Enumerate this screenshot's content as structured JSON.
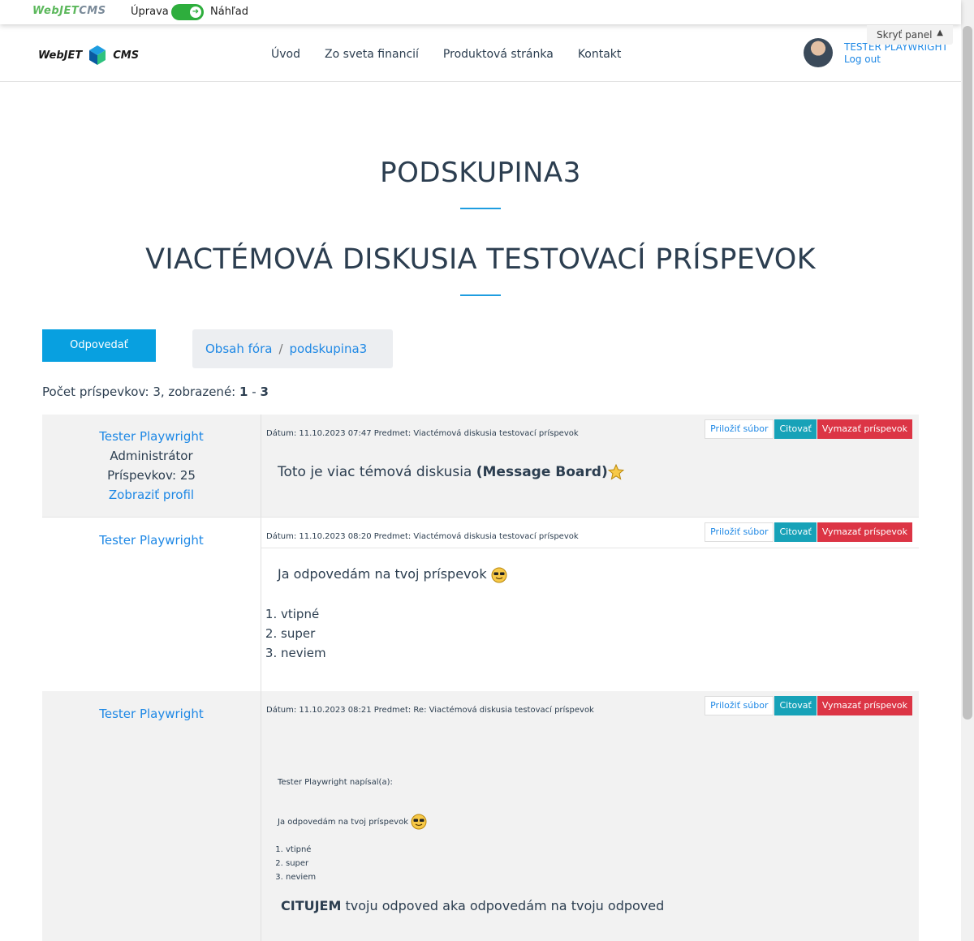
{
  "editbar": {
    "logo_a": "WebJET",
    "logo_b": "CMS",
    "mode_edit": "Úprava",
    "mode_preview": "Náhľad",
    "toggle_icon": "arrow-right-icon",
    "toggle_color": "#2eae3d"
  },
  "header": {
    "logo_a": "WebJET",
    "logo_b": "CMS",
    "nav": [
      "Úvod",
      "Zo sveta financií",
      "Produktová stránka",
      "Kontakt"
    ],
    "user_name": "TESTER PLAYWRIGHT",
    "logout": "Log out",
    "hide_panel": "Skryť panel"
  },
  "page": {
    "title1": "PODSKUPINA3",
    "title2": "VIACTÉMOVÁ DISKUSIA TESTOVACÍ PRÍSPEVOK",
    "accent_color": "#1e9de0",
    "reply_label": "Odpovedať",
    "breadcrumb": [
      "Obsah fóra",
      "podskupina3"
    ],
    "breadcrumb_sep": "/",
    "count_label": "Počet príspevkov: 3, zobrazené:",
    "count_from": "1",
    "count_dash": "-",
    "count_to": "3"
  },
  "actions": {
    "attach": "Priložiť súbor",
    "quote": "Citovať",
    "delete": "Vymazať príspevok"
  },
  "posts": [
    {
      "author": "Tester Playwright",
      "role": "Administrátor",
      "posts_count": "Príspevkov: 25",
      "profile_link": "Zobraziť profil",
      "meta": "Dátum: 11.10.2023 07:47 Predmet: Viactémová diskusia testovací príspevok",
      "text": "Toto je viac témová diskusia",
      "bold": "(Message Board)",
      "emoji": "star-emoji-icon"
    },
    {
      "author": "Tester Playwright",
      "meta": "Dátum: 11.10.2023 08:20 Predmet: Viactémová diskusia testovací príspevok",
      "text": "Ja odpovedám na tvoj príspevok",
      "emoji": "cool-sunglasses-emoji-icon",
      "list": [
        "vtipné",
        "super",
        "neviem"
      ]
    },
    {
      "author": "Tester Playwright",
      "meta": "Dátum: 11.10.2023 08:21 Predmet: Re: Viactémová diskusia testovací príspevok",
      "quote_header": "Tester Playwright napísal(a):",
      "quote_text": "Ja odpovedám na tvoj príspevok",
      "emoji": "cool-sunglasses-emoji-icon",
      "quote_list": [
        "vtipné",
        "super",
        "neviem"
      ],
      "reply_bold": "CITUJEM",
      "reply_text": "tvoju odpoved aka odpovedám na tvoju odpoved"
    }
  ]
}
